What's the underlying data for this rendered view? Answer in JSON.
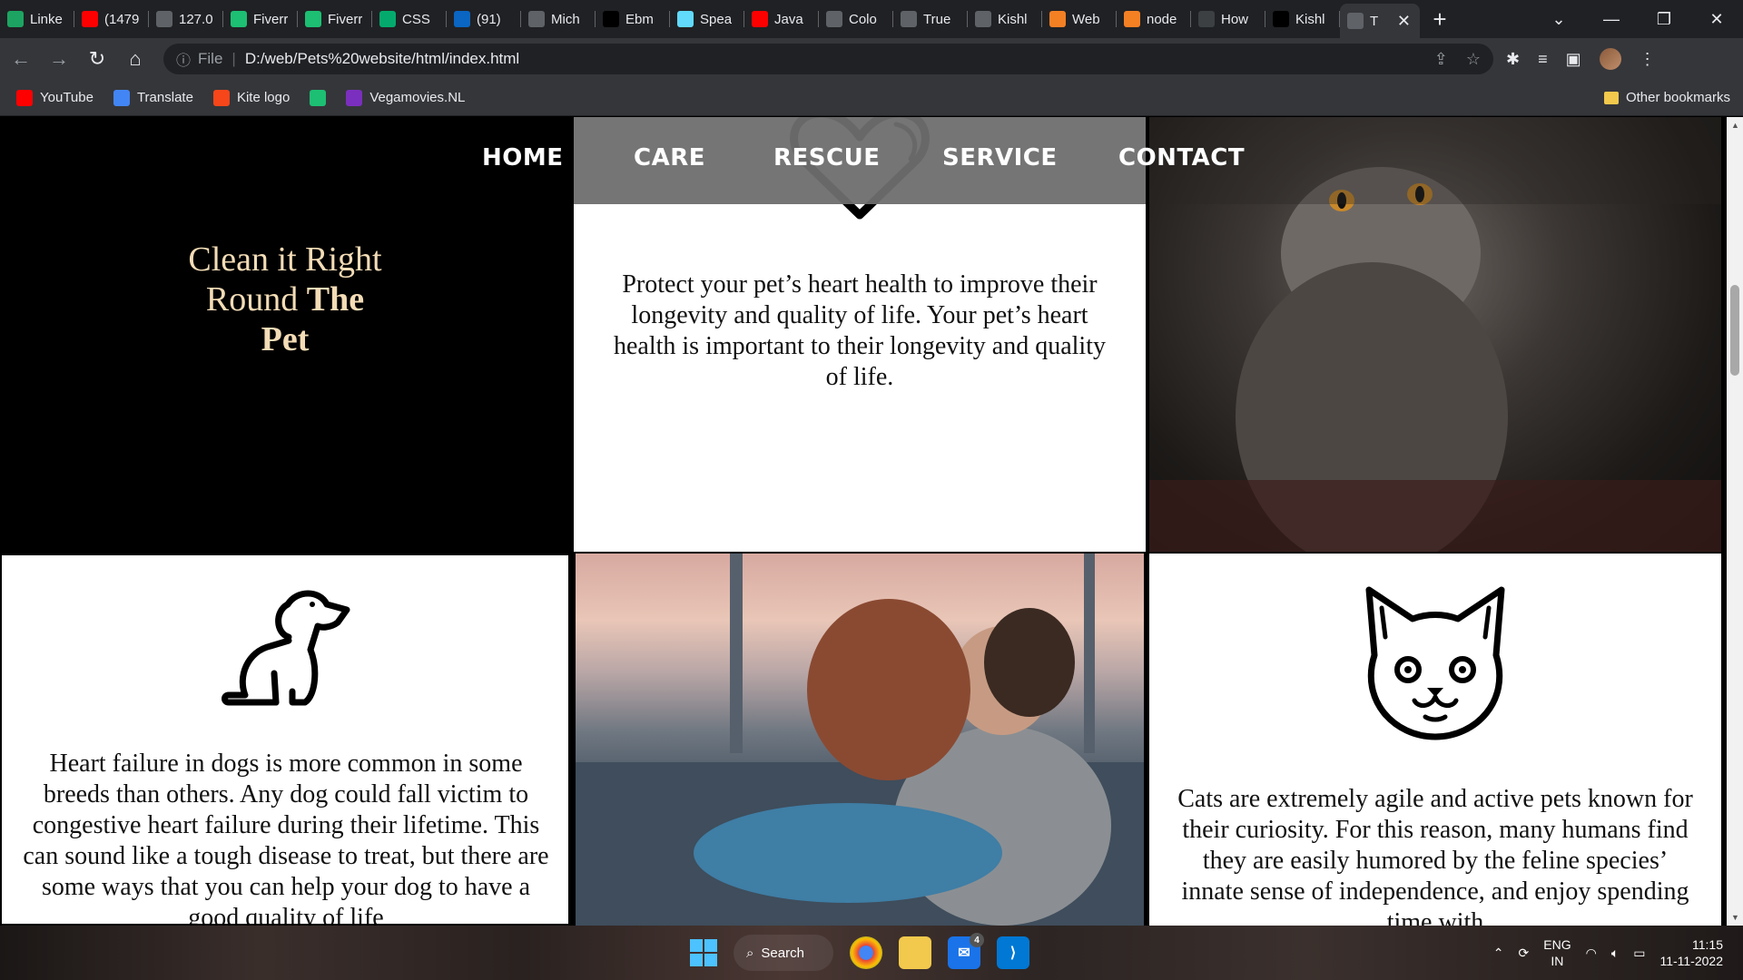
{
  "browser": {
    "tabs": [
      {
        "title": "Linke",
        "icon": "green-square-icon",
        "color": "#1da462"
      },
      {
        "title": "(1479",
        "icon": "youtube-icon",
        "color": "#ff0000"
      },
      {
        "title": "127.0",
        "icon": "globe-icon",
        "color": "#5f6368"
      },
      {
        "title": "Fiverr",
        "icon": "fiverr-icon",
        "color": "#1dbf73"
      },
      {
        "title": "Fiverr",
        "icon": "fiverr-icon",
        "color": "#1dbf73"
      },
      {
        "title": "CSS",
        "icon": "w3-icon",
        "color": "#04aa6d"
      },
      {
        "title": "(91)",
        "icon": "linkedin-icon",
        "color": "#0a66c2"
      },
      {
        "title": "Mich",
        "icon": "globe-icon",
        "color": "#5f6368"
      },
      {
        "title": "Ebm",
        "icon": "github-icon",
        "color": "#000000"
      },
      {
        "title": "Spea",
        "icon": "react-icon",
        "color": "#61dafb"
      },
      {
        "title": "Java",
        "icon": "youtube-icon",
        "color": "#ff0000"
      },
      {
        "title": "Colo",
        "icon": "globe-icon",
        "color": "#5f6368"
      },
      {
        "title": "True",
        "icon": "globe-icon",
        "color": "#5f6368"
      },
      {
        "title": "Kishl",
        "icon": "globe-icon",
        "color": "#5f6368"
      },
      {
        "title": "Web",
        "icon": "stackoverflow-icon",
        "color": "#f48024"
      },
      {
        "title": "node",
        "icon": "stackoverflow-icon",
        "color": "#f48024"
      },
      {
        "title": "How",
        "icon": "a-icon",
        "color": "#3c4043"
      },
      {
        "title": "Kishl",
        "icon": "github-icon",
        "color": "#000000"
      },
      {
        "title": "T",
        "icon": "globe-icon",
        "color": "#5f6368",
        "active": true
      }
    ],
    "address": {
      "scheme": "File",
      "url": "D:/web/Pets%20website/html/index.html"
    },
    "bookmarks": [
      {
        "label": "YouTube",
        "icon": "youtube-icon",
        "color": "#ff0000"
      },
      {
        "label": "Translate",
        "icon": "translate-icon",
        "color": "#4285f4"
      },
      {
        "label": "Kite logo",
        "icon": "kite-icon",
        "color": "#f6461a"
      },
      {
        "label": "",
        "icon": "fiverr-icon",
        "color": "#1dbf73"
      },
      {
        "label": "Vegamovies.NL",
        "icon": "v-icon",
        "color": "#7b2fbe"
      }
    ],
    "other_bookmarks": "Other bookmarks"
  },
  "page": {
    "nav": [
      "HOME",
      "CARE",
      "RESCUE",
      "SERVICE",
      "CONTACT"
    ],
    "slogan": {
      "line1": "Clean it Right",
      "line2a": "Round ",
      "line2b": "The",
      "line3": "Pet"
    },
    "heart_text": "Protect your pet’s heart health to improve their longevity and quality of life. Your pet’s heart health is important to their longevity and quality of life.",
    "dog_text": "Heart failure in dogs is more common in some breeds than others. Any dog could fall victim to congestive heart failure during their lifetime. This can sound like a tough disease to treat, but there are some ways that you can help your dog to have a good quality of life",
    "cat_text": "Cats are extremely agile and active pets known for their curiosity. For this reason, many humans find they are easily humored by the feline species’ innate sense of independence, and enjoy spending time with",
    "colors": {
      "slogan": "#f3dcb6",
      "nav_bg": "#6e6e6e"
    }
  },
  "taskbar": {
    "search": "Search",
    "mail_badge": "4",
    "lang": "ENG",
    "region": "IN",
    "time": "11:15",
    "date": "11-11-2022"
  }
}
